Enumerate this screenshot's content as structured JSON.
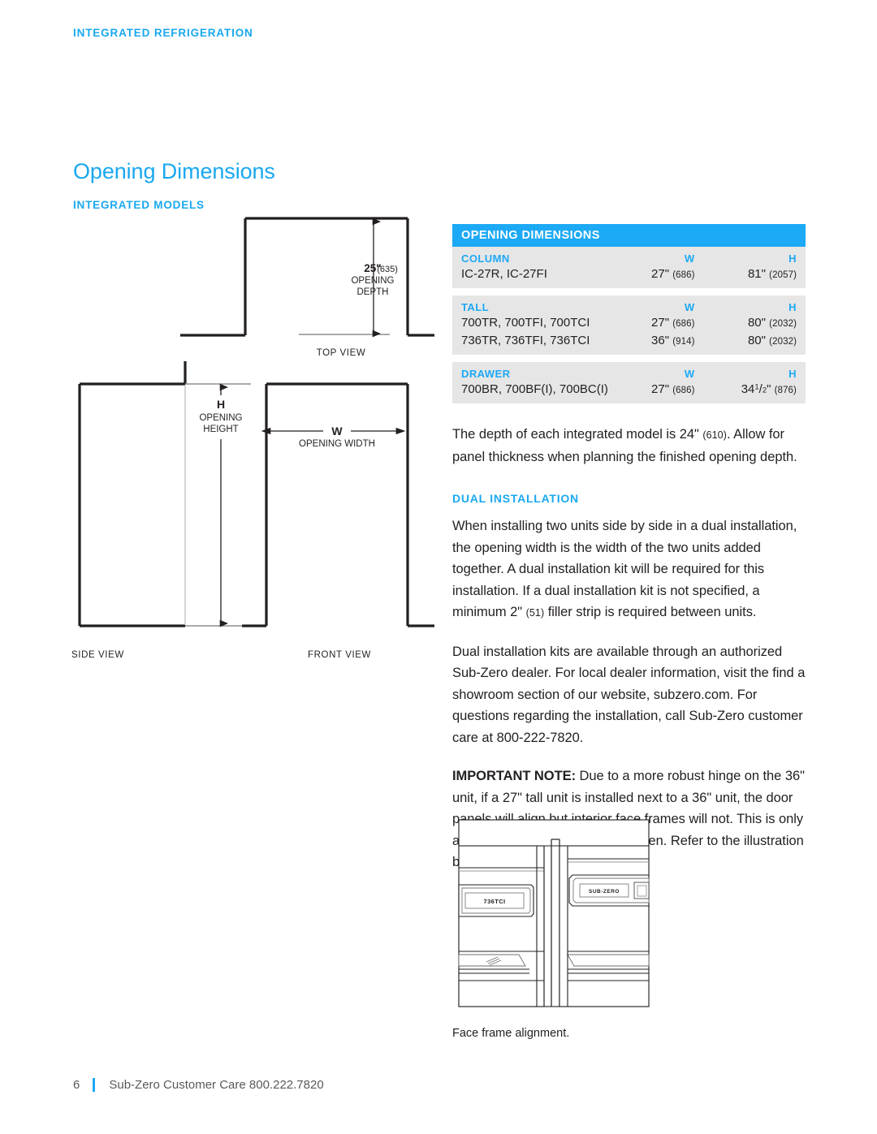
{
  "running_head": "INTEGRATED REFRIGERATION",
  "section_title": "Opening Dimensions",
  "sub_heading": "INTEGRATED MODELS",
  "colors": {
    "brand_blue": "#1ca9f5",
    "heading_blue": "#19a8f0",
    "table_row_gray": "#e6e6e6",
    "text_black": "#231f20",
    "footer_gray": "#58595b"
  },
  "drawings": {
    "top_view": {
      "label": "TOP VIEW",
      "dim_value": "25\"",
      "dim_mm": "(635)",
      "dim_line1": "OPENING",
      "dim_line2": "DEPTH"
    },
    "side_view": {
      "label": "SIDE VIEW",
      "dim_letter": "H",
      "dim_line1": "OPENING",
      "dim_line2": "HEIGHT"
    },
    "front_view": {
      "label": "FRONT VIEW",
      "dim_letter": "W",
      "dim_line1": "OPENING WIDTH"
    }
  },
  "table": {
    "title": "OPENING DIMENSIONS",
    "columns": [
      "",
      "W",
      "H"
    ],
    "groups": [
      {
        "name": "COLUMN",
        "w_header": "W",
        "h_header": "H",
        "rows": [
          {
            "model": "IC-27R, IC-27FI",
            "w_in": "27\"",
            "w_mm": "(686)",
            "h_in": "81\"",
            "h_mm": "(2057)"
          }
        ]
      },
      {
        "name": "TALL",
        "w_header": "W",
        "h_header": "H",
        "rows": [
          {
            "model": "700TR, 700TFI, 700TCI",
            "w_in": "27\"",
            "w_mm": "(686)",
            "h_in": "80\"",
            "h_mm": "(2032)"
          },
          {
            "model": "736TR, 736TFI, 736TCI",
            "w_in": "36\"",
            "w_mm": "(914)",
            "h_in": "80\"",
            "h_mm": "(2032)"
          }
        ]
      },
      {
        "name": "DRAWER",
        "w_header": "W",
        "h_header": "H",
        "rows": [
          {
            "model": "700BR, 700BF(I), 700BC(I)",
            "w_in": "27\"",
            "w_mm": "(686)",
            "h_in_prefix": "34",
            "h_in_num": "1",
            "h_in_den": "2",
            "h_in_suffix": "\"",
            "h_mm": "(876)"
          }
        ]
      }
    ]
  },
  "body": {
    "depth_note_part1": "The depth of each integrated model is 24\"",
    "depth_note_mm": "(610)",
    "depth_note_part2": ". Allow for panel thickness when planning the finished opening depth.",
    "dual_installation_heading": "DUAL INSTALLATION",
    "dual_para1_part1": "When installing two units side by side in a dual installation, the opening width is the width of the two units added together. A dual installation kit will be required for this installation. If a dual installation kit is not specified, a minimum 2\"",
    "dual_para1_mm": "(51)",
    "dual_para1_part2": " filler strip is required between units.",
    "dual_para2": "Dual installation kits are available through an authorized Sub-Zero dealer. For local dealer information, visit the find a showroom section of our website, subzero.com. For questions regarding the installation, call Sub-Zero customer care at 800-222-7820.",
    "note_label": "IMPORTANT NOTE:",
    "note_text": " Due to a more robust hinge on the 36\" unit, if a 27\" tall unit is installed next to a 36\" unit, the door panels will align but interior face frames will not. This is only apparent when both doors are open. Refer to the illustration below."
  },
  "illustration": {
    "left_unit_badge": "736TCI",
    "right_unit_badge": "SUB-ZERO",
    "caption": "Face frame alignment."
  },
  "footer": {
    "page_number": "6",
    "text": "Sub-Zero Customer Care 800.222.7820"
  }
}
